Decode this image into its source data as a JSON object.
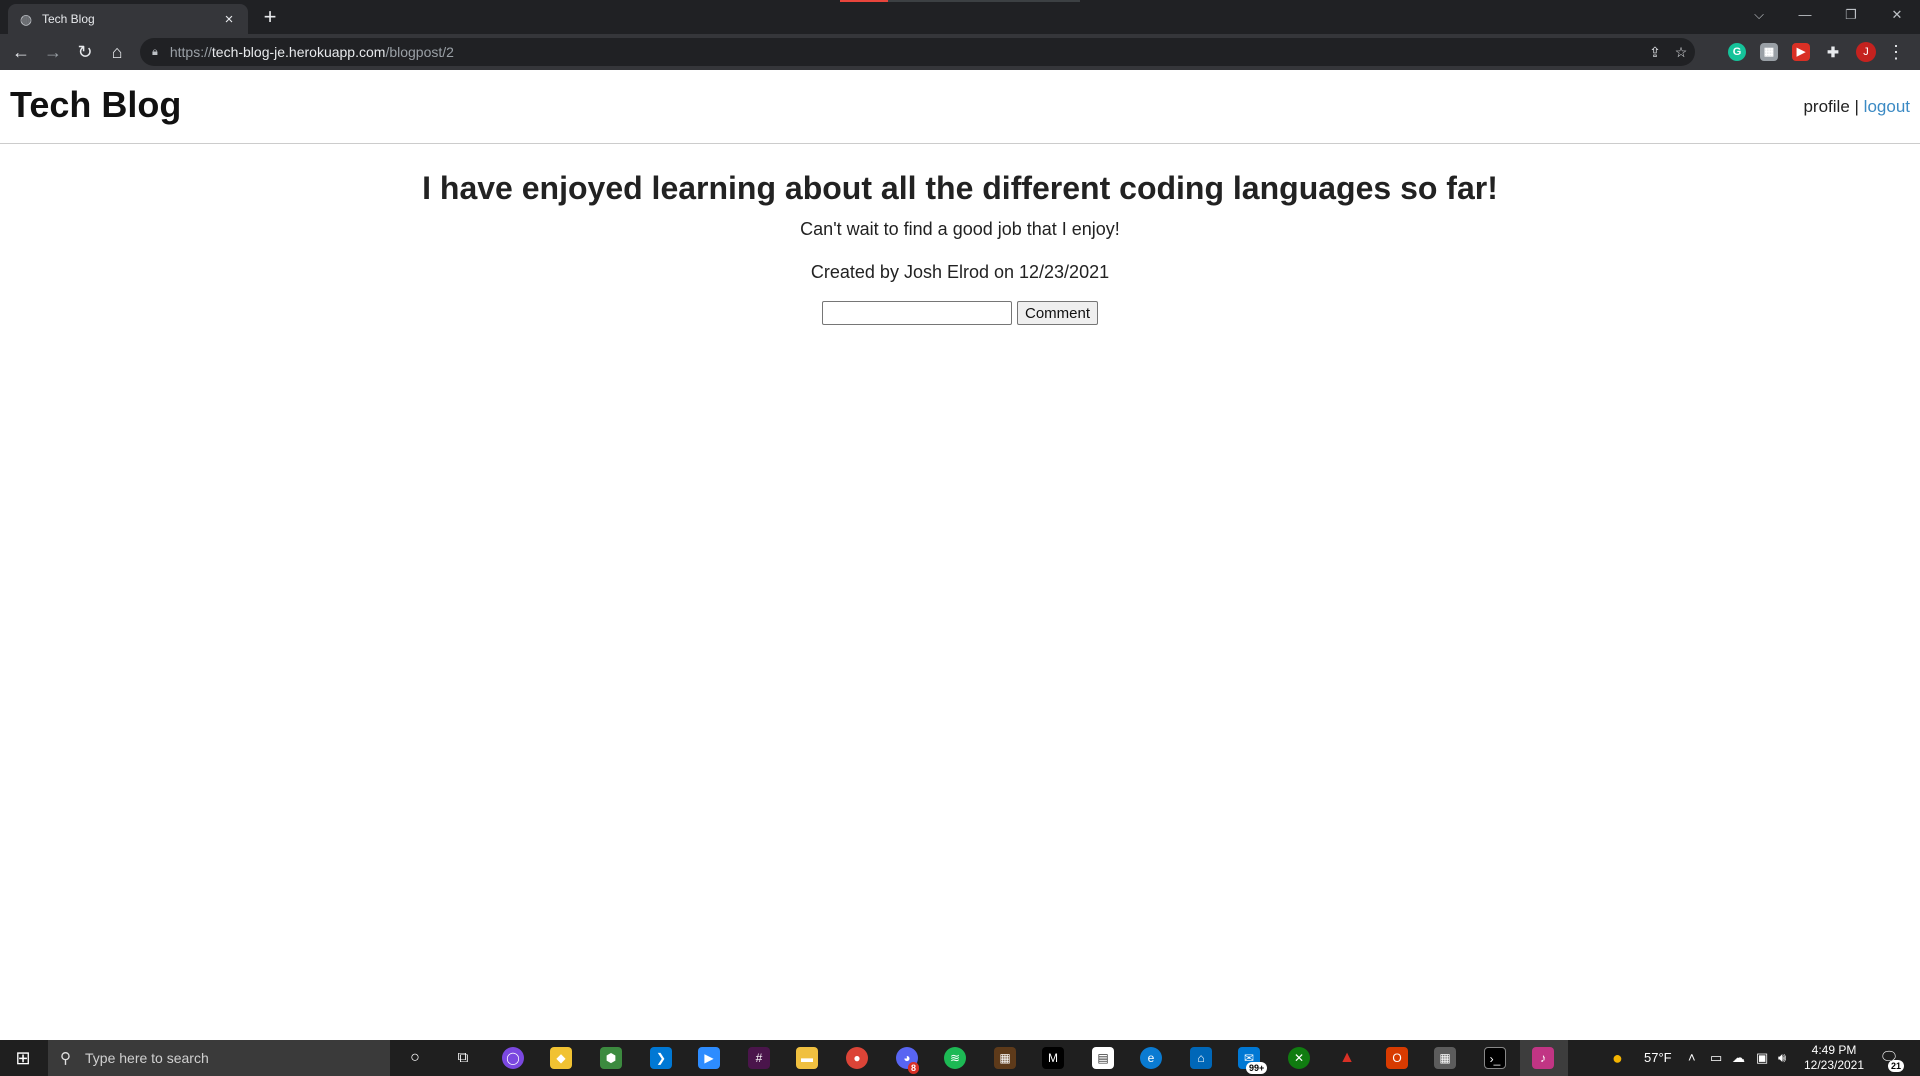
{
  "browser": {
    "tab_title": "Tech Blog",
    "tab_close": "×",
    "new_tab": "+",
    "url_scheme": "https://",
    "url_host": "tech-blog-je.herokuapp.com",
    "url_path": "/blogpost/2",
    "profile_initial": "J"
  },
  "site": {
    "title": "Tech Blog",
    "nav": {
      "profile": "profile",
      "separator": "|",
      "logout": "logout"
    }
  },
  "post": {
    "title": "I have enjoyed learning about all the different coding languages so far!",
    "body": "Can't wait to find a good job that I enjoy!",
    "meta": "Created by Josh Elrod on 12/23/2021",
    "comment_value": "",
    "comment_button": "Comment"
  },
  "taskbar": {
    "search_placeholder": "Type here to search",
    "weather": "57°F",
    "time": "4:49 PM",
    "date": "12/23/2021",
    "mail_badge": "99+",
    "discord_badge": "8",
    "notif_count": "21"
  },
  "colors": {
    "link": "#3b8ac4",
    "chrome_dark": "#202124",
    "taskbar": "#1f1f1f"
  }
}
